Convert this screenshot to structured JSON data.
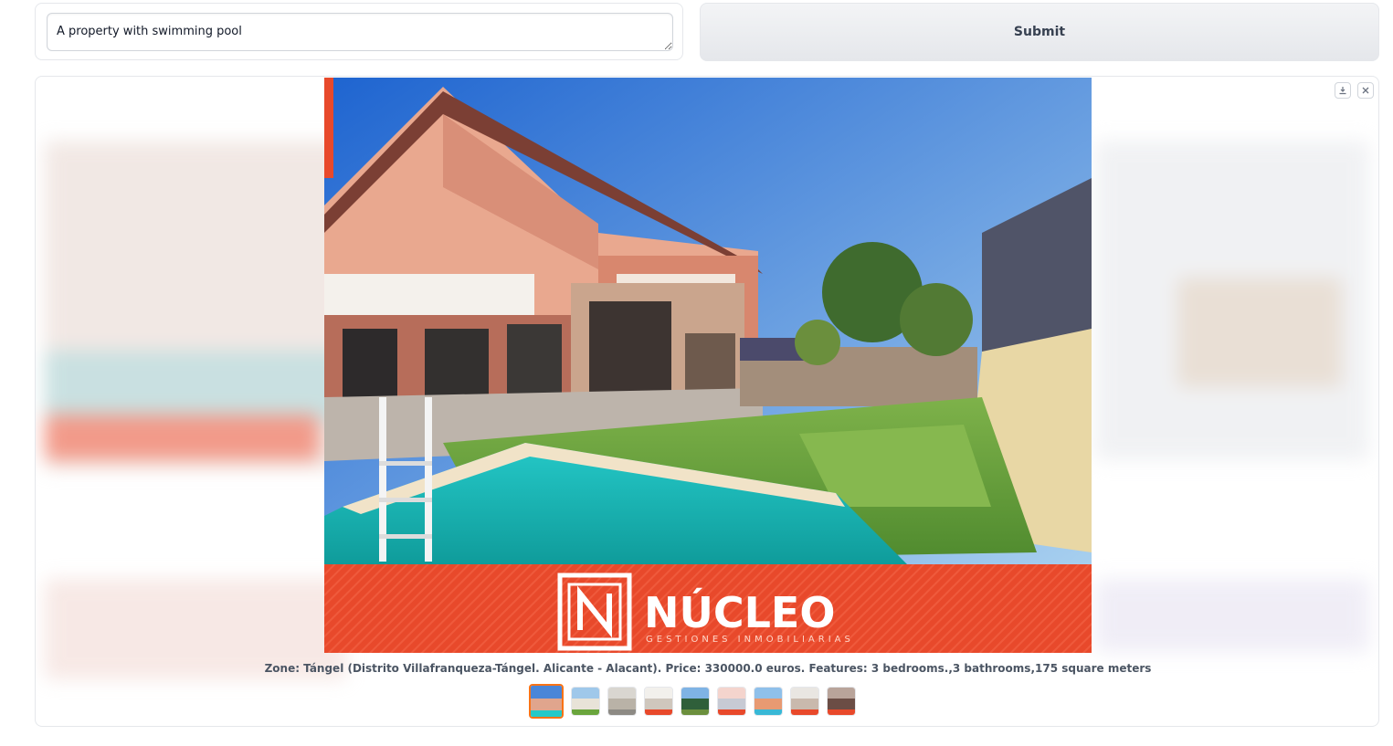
{
  "query": {
    "value": "A property with swimming pool",
    "placeholder": ""
  },
  "submit": {
    "label": "Submit"
  },
  "gallery": {
    "download_icon": "download-icon",
    "close_icon": "close-icon",
    "caption": "Zone: Tángel (Distrito Villafranqueza-Tángel. Alicante - Alacant). Price: 330000.0 euros. Features: 3 bedrooms.,3 bathrooms,175 square meters",
    "logo_text": "NÚCLEO",
    "logo_subtext": "GESTIONES INMOBILIARIAS",
    "selected_index": 0,
    "thumbnail_count": 9
  },
  "colors": {
    "accent": "#f97316",
    "brand_band": "#e8492b"
  }
}
